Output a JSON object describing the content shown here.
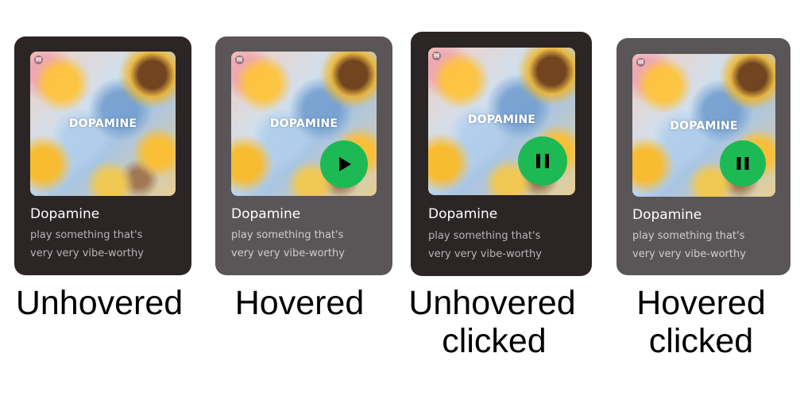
{
  "cards": [
    {
      "state": "unhovered",
      "cover_text": "DOPAMINE",
      "title": "Dopamine",
      "desc_line1": "play something that's",
      "desc_line2": "very very vibe-worthy",
      "button": "none",
      "background": "#2b2526"
    },
    {
      "state": "hovered",
      "cover_text": "DOPAMINE",
      "title": "Dopamine",
      "desc_line1": "play something that's",
      "desc_line2": "very very vibe-worthy",
      "button": "play-icon",
      "background": "#5a5556"
    },
    {
      "state": "unhovered-clicked",
      "cover_text": "DOPAMINE",
      "title": "Dopamine",
      "desc_line1": "play something that's",
      "desc_line2": "very very vibe-worthy",
      "button": "pause-icon",
      "background": "#2b2526"
    },
    {
      "state": "hovered-clicked",
      "cover_text": "DOPAMINE",
      "title": "Dopamine",
      "desc_line1": "play something that's",
      "desc_line2": "very very vibe-worthy",
      "button": "pause-icon",
      "background": "#5a5556"
    }
  ],
  "labels": {
    "unhovered": "Unhovered",
    "hovered": "Hovered",
    "unhovered_clicked_line1": "Unhovered",
    "unhovered_clicked_line2": "clicked",
    "hovered_clicked_line1": "Hovered",
    "hovered_clicked_line2": "clicked"
  },
  "colors": {
    "play_button": "#1db954",
    "play_glyph": "#000000"
  }
}
